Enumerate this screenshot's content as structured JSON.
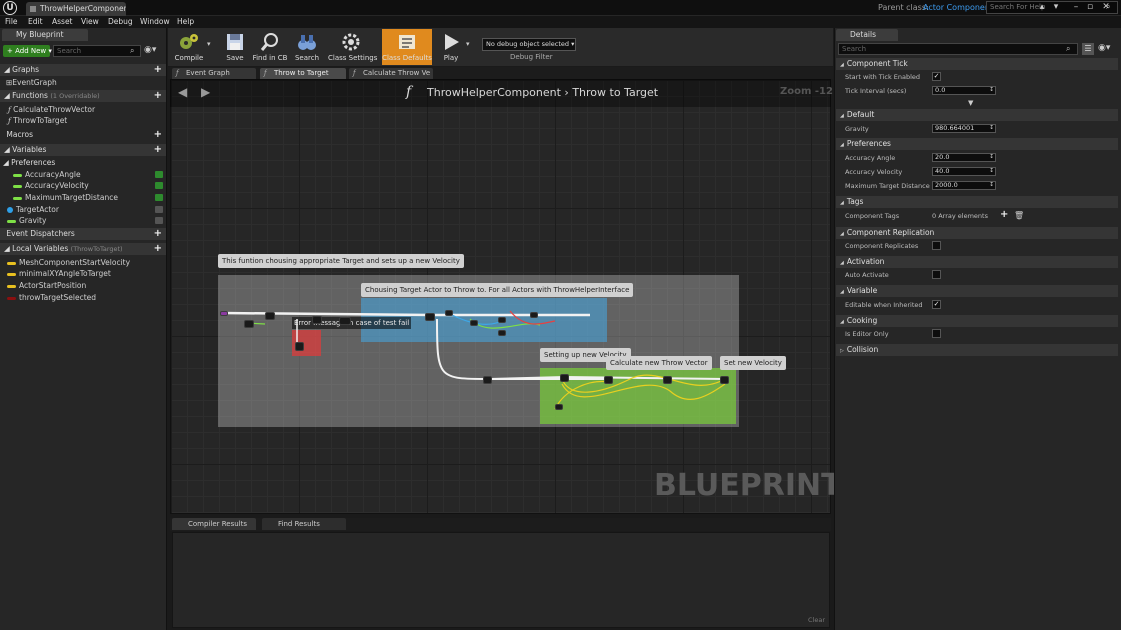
{
  "window": {
    "tab_title": "ThrowHelperComponent",
    "parent_class_label": "Parent class:",
    "parent_class_value": "Actor Component",
    "help_search_placeholder": "Search For Help"
  },
  "menu": [
    "File",
    "Edit",
    "Asset",
    "View",
    "Debug",
    "Window",
    "Help"
  ],
  "my_blueprint": {
    "tab": "My Blueprint",
    "add_new": "+ Add New ▾",
    "search_placeholder": "Search",
    "graphs_header": "Graphs",
    "graphs": [
      "EventGraph"
    ],
    "functions_header": "Functions",
    "functions_note": "(1 Overridable)",
    "functions": [
      "CalculateThrowVector",
      "ThrowToTarget"
    ],
    "macros_header": "Macros",
    "variables_header": "Variables",
    "preferences_group": "Preferences",
    "variables": [
      {
        "name": "AccuracyAngle",
        "color": "#7ee046",
        "eye": "green"
      },
      {
        "name": "AccuracyVelocity",
        "color": "#7ee046",
        "eye": "green"
      },
      {
        "name": "MaximumTargetDistance",
        "color": "#7ee046",
        "eye": "green"
      },
      {
        "name": "TargetActor",
        "color": "#2ea0e8",
        "eye": "gray"
      },
      {
        "name": "Gravity",
        "color": "#7ee046",
        "eye": "gray"
      }
    ],
    "event_dispatchers_header": "Event Dispatchers",
    "local_variables_header": "Local Variables",
    "local_variables_note": "(ThrowToTarget)",
    "local_variables": [
      {
        "name": "MeshComponentStartVelocity",
        "color": "#e8c020"
      },
      {
        "name": "minimalXYAngleToTarget",
        "color": "#e8c020"
      },
      {
        "name": "ActorStartPosition",
        "color": "#e8c020"
      },
      {
        "name": "throwTargetSelected",
        "color": "#8a1010"
      }
    ]
  },
  "toolbar": {
    "compile": "Compile",
    "save": "Save",
    "find_in_cb": "Find in CB",
    "search": "Search",
    "class_settings": "Class Settings",
    "class_defaults": "Class Defaults",
    "play": "Play",
    "debug_select": "No debug object selected ▾",
    "debug_filter": "Debug Filter"
  },
  "graph_tabs": [
    "Event Graph",
    "Throw to Target",
    "Calculate Throw Ve"
  ],
  "graph": {
    "breadcrumb": "ThrowHelperComponent  ›  Throw to Target",
    "zoom": "Zoom -12",
    "watermark": "BLUEPRINT",
    "comments": {
      "main": "This funtion chousing appropriate Target and sets up a new Velocity",
      "choosing": "Chousing Target Actor to Throw to. For all Actors with ThrowHelperInterface",
      "error": "Error message in case of test fail",
      "setting": "Setting up new Velocity",
      "calculate": "Calculate new Throw Vector",
      "set": "Set new Velocity"
    }
  },
  "bottom": {
    "tabs": [
      "Compiler Results",
      "Find Results"
    ],
    "clear": "Clear"
  },
  "details": {
    "tab": "Details",
    "search_placeholder": "Search",
    "categories": {
      "component_tick": "Component Tick",
      "default": "Default",
      "preferences": "Preferences",
      "tags": "Tags",
      "component_replication": "Component Replication",
      "activation": "Activation",
      "variable": "Variable",
      "cooking": "Cooking",
      "collision": "Collision"
    },
    "props": {
      "start_with_tick": "Start with Tick Enabled",
      "tick_interval": "Tick Interval (secs)",
      "tick_interval_value": "0.0",
      "gravity": "Gravity",
      "gravity_value": "980.664001",
      "accuracy_angle": "Accuracy Angle",
      "accuracy_angle_value": "20.0",
      "accuracy_velocity": "Accuracy Velocity",
      "accuracy_velocity_value": "40.0",
      "max_target_distance": "Maximum Target Distance",
      "max_target_distance_value": "2000.0",
      "component_tags": "Component Tags",
      "component_tags_value": "0 Array elements",
      "component_replicates": "Component Replicates",
      "auto_activate": "Auto Activate",
      "editable_when_inherited": "Editable when Inherited",
      "is_editor_only": "Is Editor Only"
    }
  },
  "colors": {
    "accent_orange": "#e08a1e",
    "link_blue": "#3d9cf0",
    "add_new_green": "#2f7f1f"
  }
}
